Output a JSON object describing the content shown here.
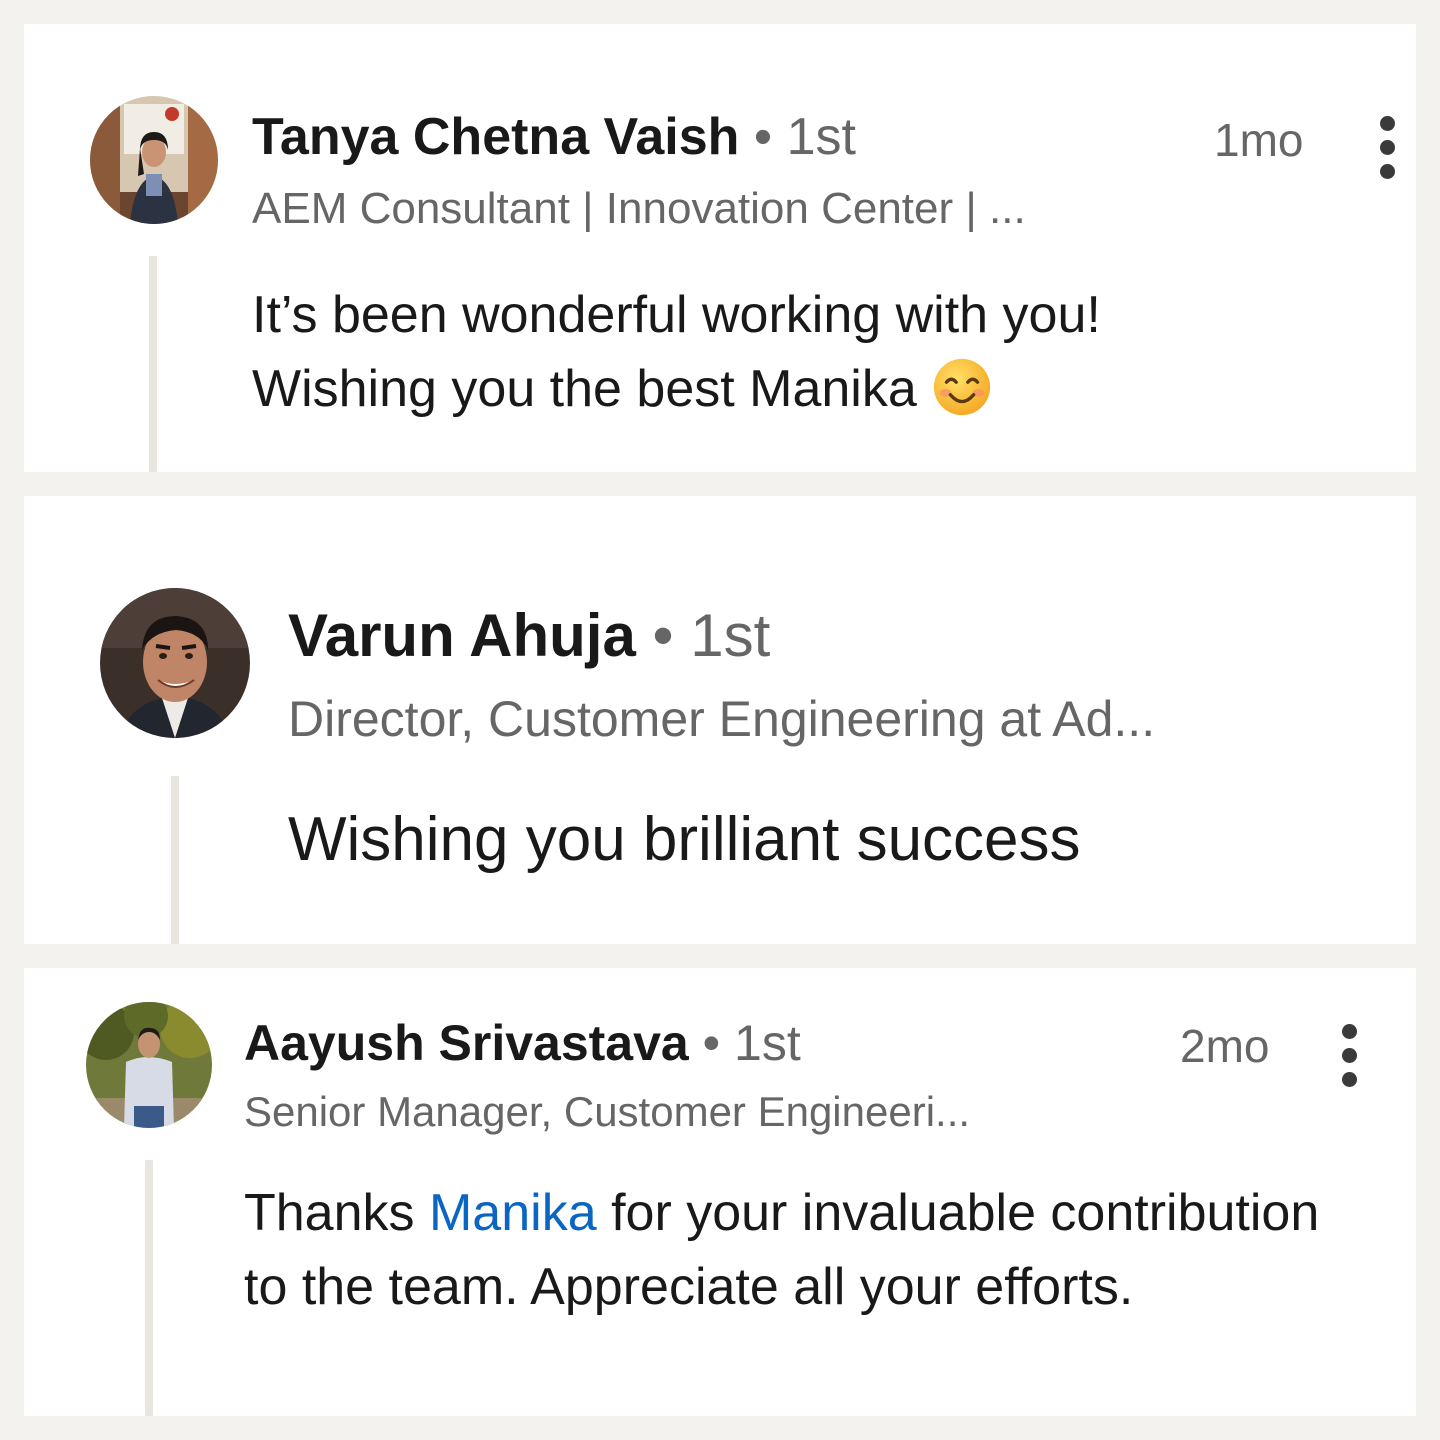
{
  "comments": [
    {
      "author": "Tanya Chetna Vaish",
      "separator": "•",
      "degree": "1st",
      "headline": "AEM Consultant | Innovation Center | ...",
      "time": "1mo",
      "text_lines": [
        "It’s been wonderful working with you!",
        "Wishing you the best Manika"
      ],
      "emoji": "smiling-face-emoji"
    },
    {
      "author": "Varun Ahuja",
      "separator": "•",
      "degree": "1st",
      "headline": "Director, Customer Engineering at Ad...",
      "text": "Wishing you brilliant success"
    },
    {
      "author": "Aayush Srivastava",
      "separator": "•",
      "degree": "1st",
      "headline": "Senior Manager, Customer Engineeri...",
      "time": "2mo",
      "text_before": "Thanks ",
      "mention": "Manika",
      "text_after": " for your invaluable contribution to the team. Appreciate all your efforts."
    }
  ],
  "colors": {
    "background": "#f4f2ee",
    "card": "#ffffff",
    "primary_text": "#191919",
    "secondary_text": "#666666",
    "mention": "#0a66c2",
    "thread_line": "#e9e5df"
  },
  "icons": {
    "more": "more-vertical-icon"
  }
}
